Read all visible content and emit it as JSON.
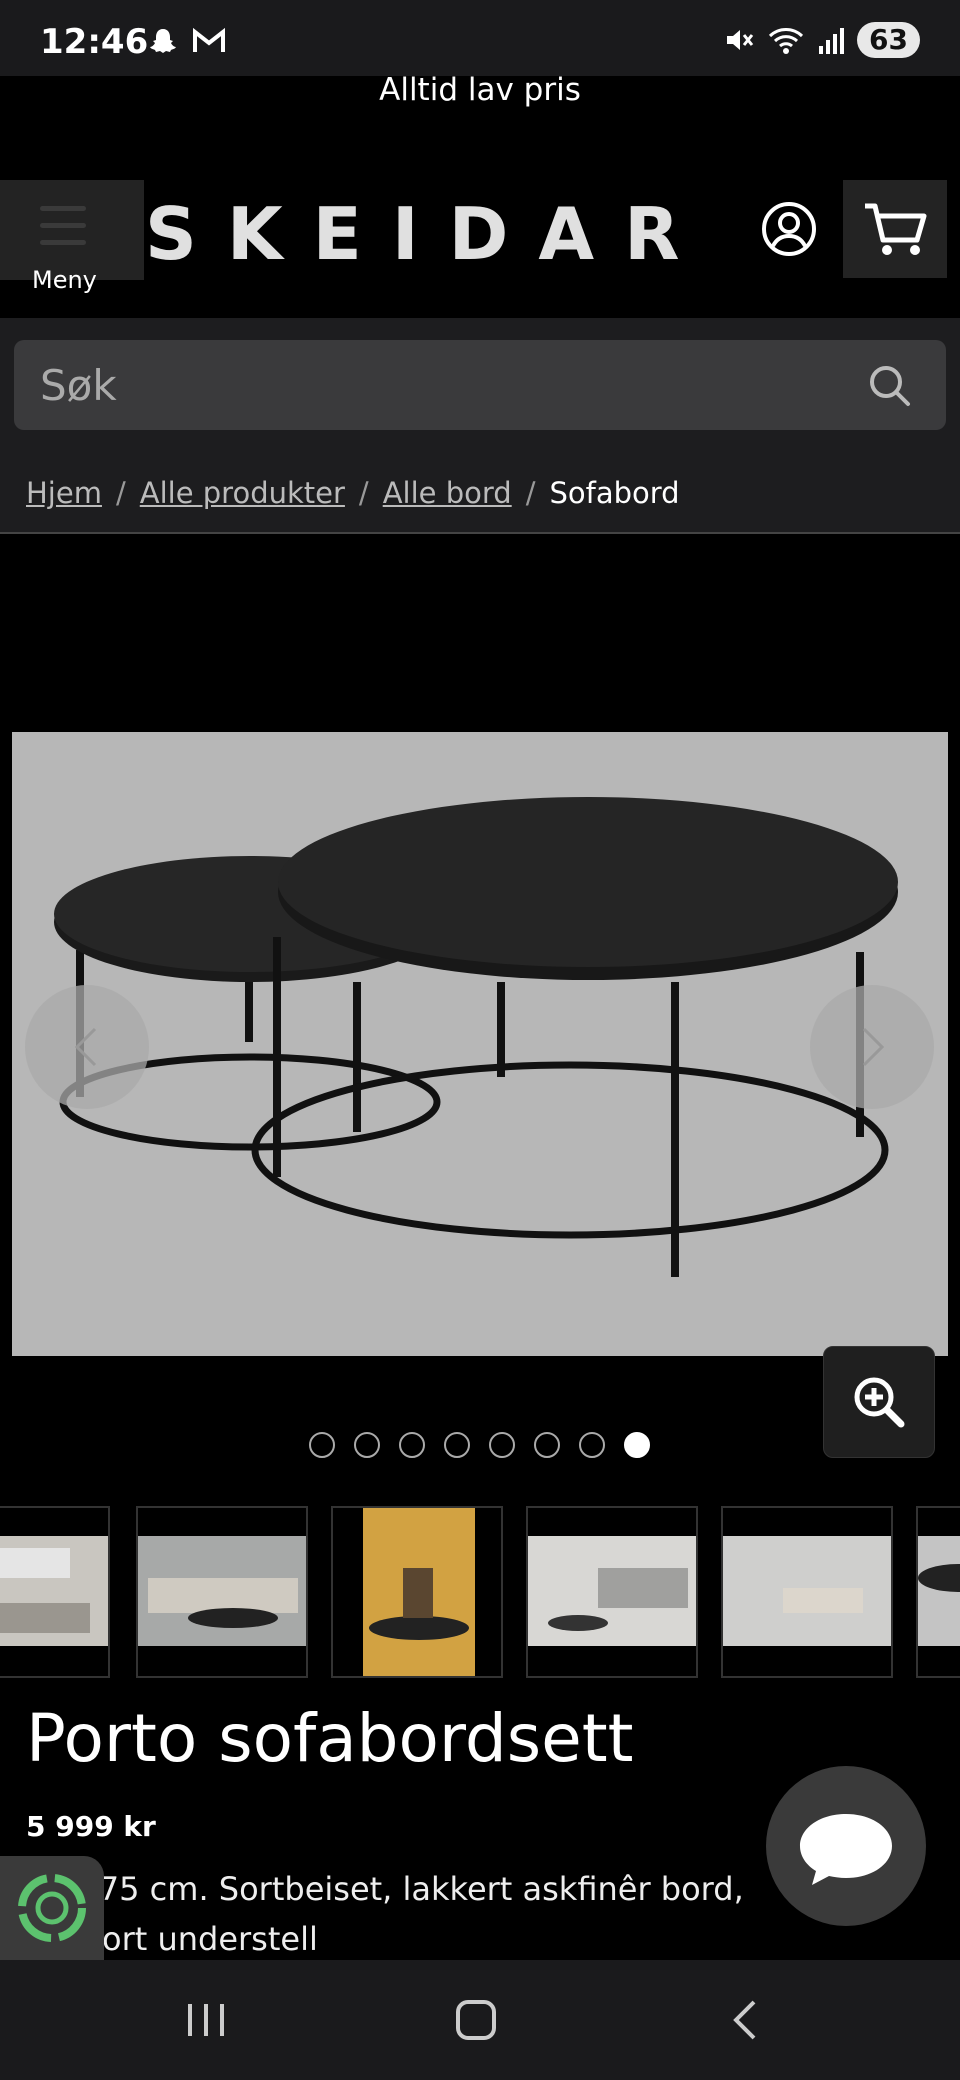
{
  "status_bar": {
    "time": "12:46",
    "battery": "63",
    "left_icons": [
      "snapchat-icon",
      "gmail-icon"
    ],
    "right_icons": [
      "mute-icon",
      "wifi-icon",
      "signal-icon",
      "battery-icon"
    ]
  },
  "promo": {
    "text": "Alltid lav pris"
  },
  "header": {
    "menu_label": "Meny",
    "logo": "SKEIDAR"
  },
  "search": {
    "placeholder": "Søk"
  },
  "breadcrumb": {
    "items": [
      "Hjem",
      "Alle produkter",
      "Alle bord"
    ],
    "current": "Sofabord",
    "separator": "/"
  },
  "gallery": {
    "dot_count": 8,
    "active_dot": 8
  },
  "product": {
    "title": "Porto sofabordsett",
    "price": "5 999 kr",
    "description_line1": "/75 cm. Sortbeiset, lakkert askfinêr bord,",
    "description_line2": "ort understell"
  },
  "colors": {
    "background": "#000000",
    "panel": "#1d1d1f",
    "search_field": "#3a3a3c",
    "image_bg": "#b7b7b7"
  }
}
